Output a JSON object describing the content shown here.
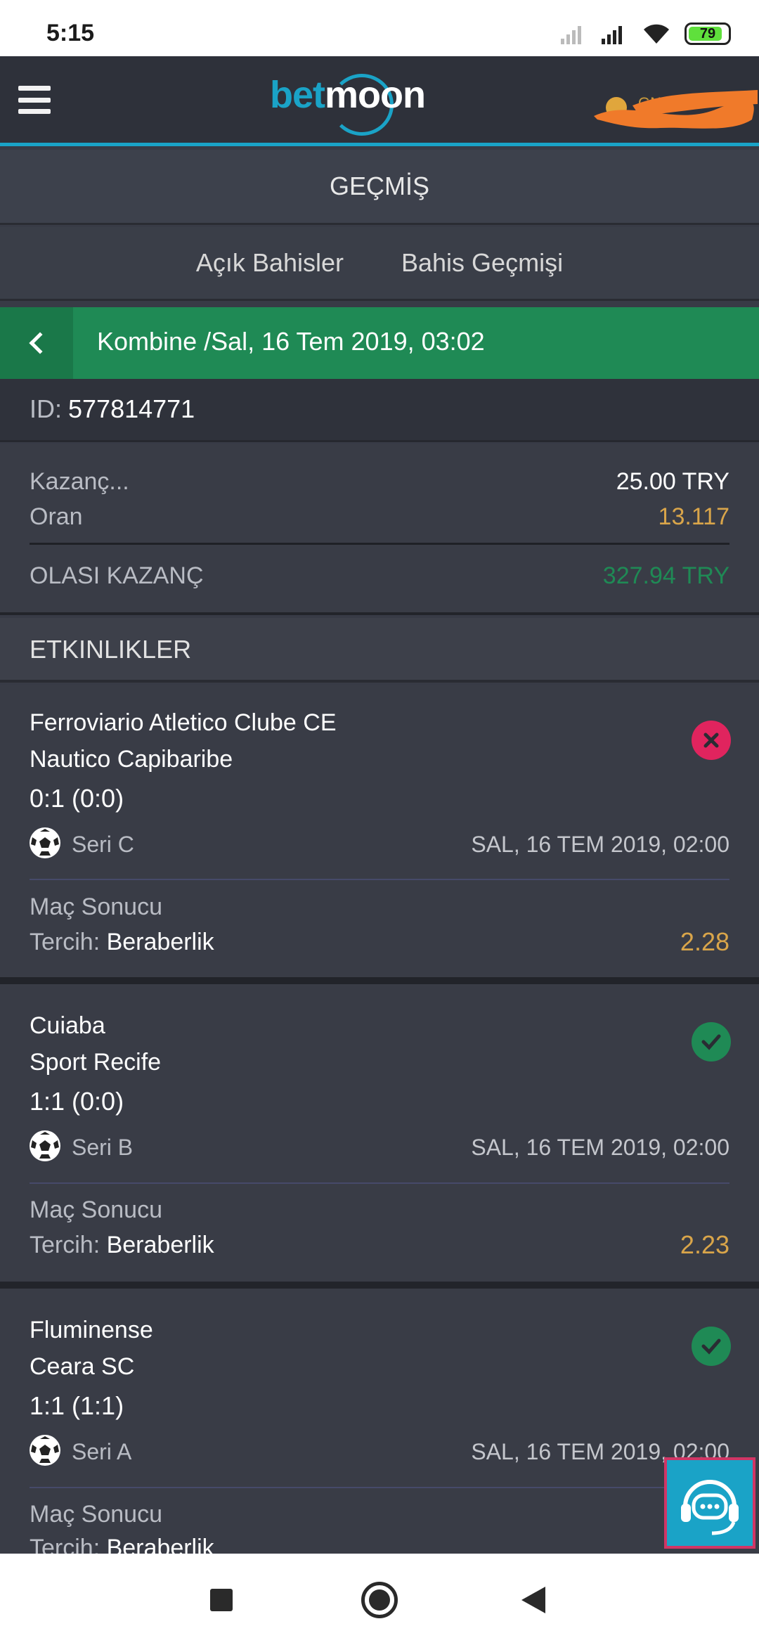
{
  "status_bar": {
    "time": "5:15",
    "battery": "79"
  },
  "header": {
    "logo_bet": "bet",
    "logo_moon": "moon",
    "user_name": "GNYO"
  },
  "page": {
    "title": "GEÇMİŞ"
  },
  "tabs": [
    {
      "label": "Açık Bahisler"
    },
    {
      "label": "Bahis Geçmişi"
    }
  ],
  "bet": {
    "header": "Kombine /Sal, 16 Tem 2019, 03:02",
    "id_label": "ID:",
    "id_value": "577814771",
    "stake_label": "Kazanç...",
    "stake_value": "25.00 TRY",
    "odds_label": "Oran",
    "odds_value": "13.117",
    "potential_label": "OLASI KAZANÇ",
    "potential_value": "327.94 TRY"
  },
  "events_title": "ETKINLIKLER",
  "events": [
    {
      "home": "Ferroviario Atletico Clube CE",
      "away": "Nautico Capibaribe",
      "score": "0:1 (0:0)",
      "league": "Seri C",
      "date": "SAL, 16 TEM 2019, 02:00",
      "market": "Maç Sonucu",
      "pick_label": "Tercih:",
      "pick_value": "Beraberlik",
      "odd": "2.28",
      "status": "lost"
    },
    {
      "home": "Cuiaba",
      "away": "Sport Recife",
      "score": "1:1 (0:0)",
      "league": "Seri B",
      "date": "SAL, 16 TEM 2019, 02:00",
      "market": "Maç Sonucu",
      "pick_label": "Tercih:",
      "pick_value": "Beraberlik",
      "odd": "2.23",
      "status": "won"
    },
    {
      "home": "Fluminense",
      "away": "Ceara SC",
      "score": "1:1 (1:1)",
      "league": "Seri A",
      "date": "SAL, 16 TEM 2019, 02:00",
      "market": "Maç Sonucu",
      "pick_label": "Tercih:",
      "pick_value": "Beraberlik",
      "odd": "",
      "status": "won"
    }
  ],
  "colors": {
    "accent": "#1aa3c7",
    "green_bar": "#1f8a55",
    "odds": "#d9a54a",
    "potential": "#1f8a55",
    "lost": "#e0245e",
    "won": "#1f8a55"
  },
  "icons": {
    "menu": "hamburger-icon",
    "back": "chevron-left-icon",
    "ball": "soccer-ball-icon",
    "lost": "close-circle-icon",
    "won": "check-circle-icon",
    "chat": "chat-support-icon"
  }
}
